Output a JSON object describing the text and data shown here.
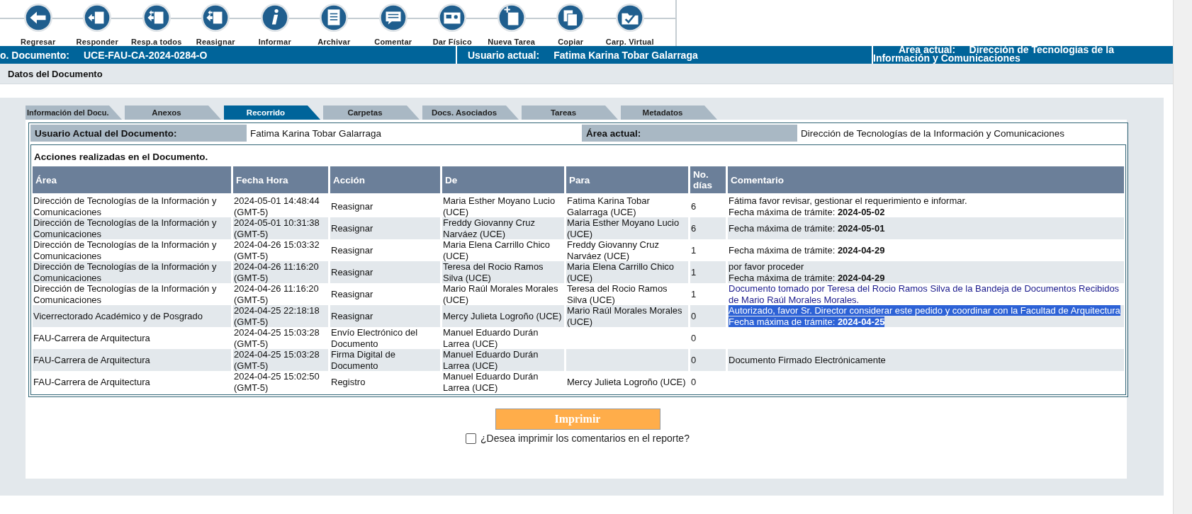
{
  "toolbar": [
    {
      "label": "Regresar"
    },
    {
      "label": "Responder"
    },
    {
      "label": "Resp.a todos"
    },
    {
      "label": "Reasignar"
    },
    {
      "label": "Informar"
    },
    {
      "label": "Archivar"
    },
    {
      "label": "Comentar"
    },
    {
      "label": "Dar Físico"
    },
    {
      "label": "Nueva Tarea"
    },
    {
      "label": "Copiar"
    },
    {
      "label": "Carp. Virtual"
    }
  ],
  "header_bar": {
    "document_label": "o. Documento:",
    "document_number": "UCE-FAU-CA-2024-0284-O",
    "user_label": "Usuario actual:",
    "user": "Fatima Karina Tobar Galarraga",
    "area_label": "Area actual:",
    "area": "Dirección de Tecnologías de la Información y Comunicaciones"
  },
  "section_title": "Datos del Documento",
  "tabs": [
    {
      "label": "Información del Docu.",
      "selected": false
    },
    {
      "label": "Anexos",
      "selected": false
    },
    {
      "label": "Recorrido",
      "selected": true
    },
    {
      "label": "Carpetas",
      "selected": false
    },
    {
      "label": "Docs. Asociados",
      "selected": false
    },
    {
      "label": "Tareas",
      "selected": false
    },
    {
      "label": "Metadatos",
      "selected": false
    }
  ],
  "info": {
    "user_label": "Usuario Actual del Documento:",
    "user": "Fatima Karina Tobar Galarraga",
    "area_label": "Área actual:",
    "area": "Dirección de Tecnologías de la Información y Comunicaciones"
  },
  "actions_title": "Acciones realizadas en el Documento.",
  "table": {
    "columns": [
      "Área",
      "Fecha Hora",
      "Acción",
      "De",
      "Para",
      "No. días",
      "Comentario"
    ],
    "rows": [
      {
        "area": "Dirección de Tecnologías de la Información y Comunicaciones",
        "date": "2024-05-01 14:48:44 (GMT-5)",
        "action": "Reasignar",
        "from": "Maria Esther Moyano Lucio (UCE)",
        "to": "Fatima Karina Tobar Galarraga (UCE)",
        "days": "6",
        "comment": {
          "kind": "plain",
          "highlighted": false,
          "lines": [
            "Fátima favor revisar, gestionar el requerimiento e informar.",
            "Fecha máxima de trámite: **2024-05-02**"
          ]
        }
      },
      {
        "area": "Dirección de Tecnologías de la Información y Comunicaciones",
        "date": "2024-05-01 10:31:38 (GMT-5)",
        "action": "Reasignar",
        "from": "Freddy Giovanny Cruz Narváez (UCE)",
        "to": "Maria Esther Moyano Lucio (UCE)",
        "days": "6",
        "comment": {
          "kind": "plain",
          "highlighted": false,
          "lines": [
            "Fecha máxima de trámite: **2024-05-01**"
          ]
        }
      },
      {
        "area": "Dirección de Tecnologías de la Información y Comunicaciones",
        "date": "2024-04-26 15:03:32 (GMT-5)",
        "action": "Reasignar",
        "from": "Maria Elena Carrillo Chico (UCE)",
        "to": "Freddy Giovanny Cruz Narváez (UCE)",
        "days": "1",
        "comment": {
          "kind": "plain",
          "highlighted": false,
          "lines": [
            "Fecha máxima de trámite: **2024-04-29**"
          ]
        }
      },
      {
        "area": "Dirección de Tecnologías de la Información y Comunicaciones",
        "date": "2024-04-26 11:16:20 (GMT-5)",
        "action": "Reasignar",
        "from": "Teresa del Rocio Ramos Silva (UCE)",
        "to": "Maria Elena Carrillo Chico (UCE)",
        "days": "1",
        "comment": {
          "kind": "plain",
          "highlighted": false,
          "lines": [
            "por favor proceder",
            "Fecha máxima de trámite: **2024-04-29**"
          ]
        }
      },
      {
        "area": "Dirección de Tecnologías de la Información y Comunicaciones",
        "date": "2024-04-26 11:16:20 (GMT-5)",
        "action": "Reasignar",
        "from": "Mario Raúl Morales Morales (UCE)",
        "to": "Teresa del Rocio Ramos Silva (UCE)",
        "days": "1",
        "comment": {
          "kind": "system",
          "highlighted": false,
          "lines": [
            "Documento tomado por Teresa del Rocio Ramos Silva de la Bandeja de Documentos Recibidos de Mario Raúl Morales Morales."
          ]
        }
      },
      {
        "area": "Vicerrectorado Académico y de Posgrado",
        "date": "2024-04-25 22:18:18 (GMT-5)",
        "action": "Reasignar",
        "from": "Mercy Julieta Logroño (UCE)",
        "to": "Mario Raúl Morales Morales (UCE)",
        "days": "0",
        "comment": {
          "kind": "system",
          "highlighted": true,
          "lines": [
            "Autorizado, favor Sr. Director considerar este pedido y coordinar con la Facultad de Arquitectura",
            "Fecha máxima de trámite: **2024-04-25**"
          ]
        }
      },
      {
        "area": "FAU-Carrera de Arquitectura",
        "date": "2024-04-25 15:03:28 (GMT-5)",
        "action": "Envío Electrónico del Documento",
        "from": "Manuel Eduardo Durán Larrea (UCE)",
        "days": "0"
      },
      {
        "area": "FAU-Carrera de Arquitectura",
        "date": "2024-04-25 15:03:28 (GMT-5)",
        "action": "Firma Digital de Documento",
        "from": "Manuel Eduardo Durán Larrea (UCE)",
        "days": "0",
        "comment": {
          "kind": "plain",
          "highlighted": false,
          "lines": [
            "Documento Firmado Electrónicamente"
          ]
        }
      },
      {
        "area": "FAU-Carrera de Arquitectura",
        "date": "2024-04-25 15:02:50 (GMT-5)",
        "action": "Registro",
        "from": "Manuel Eduardo Durán Larrea (UCE)",
        "to": "Mercy Julieta Logroño (UCE)",
        "days": "0"
      }
    ]
  },
  "print_button": "Imprimir",
  "print_comments": {
    "label": "¿Desea imprimir los comentarios en el reporte?",
    "checked": false
  }
}
